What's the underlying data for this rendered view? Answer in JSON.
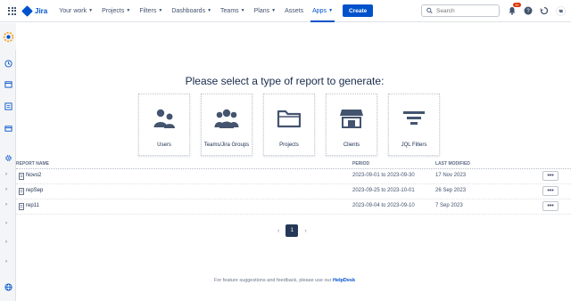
{
  "nav": {
    "logo_text": "Jira",
    "items": [
      {
        "label": "Your work",
        "chevron": true
      },
      {
        "label": "Projects",
        "chevron": true
      },
      {
        "label": "Filters",
        "chevron": true
      },
      {
        "label": "Dashboards",
        "chevron": true
      },
      {
        "label": "Teams",
        "chevron": true
      },
      {
        "label": "Plans",
        "chevron": true
      },
      {
        "label": "Assets",
        "chevron": false
      },
      {
        "label": "Apps",
        "chevron": true,
        "active": true
      }
    ],
    "create_label": "Create",
    "search_placeholder": "Search",
    "notification_count": "9+"
  },
  "main": {
    "heading": "Please select a type of report to generate:",
    "report_types": [
      {
        "label": "Users",
        "icon": "users-icon"
      },
      {
        "label": "Teams/Jira Groups",
        "icon": "groups-icon"
      },
      {
        "label": "Projects",
        "icon": "folder-icon"
      },
      {
        "label": "Clients",
        "icon": "store-icon"
      },
      {
        "label": "JQL Filters",
        "icon": "filter-icon"
      }
    ],
    "table": {
      "columns": {
        "name": "REPORT NAME",
        "period": "PERIOD",
        "modified": "LAST MODIFIED"
      },
      "rows": [
        {
          "name": "Novo2",
          "period": "2023-09-01 to 2023-09-30",
          "modified": "17 Nov 2023"
        },
        {
          "name": "repSep",
          "period": "2023-09-25 to 2023-10-01",
          "modified": "26 Sep 2023"
        },
        {
          "name": "rep11",
          "period": "2023-09-04 to 2023-09-10",
          "modified": "7 Sep 2023"
        }
      ],
      "row_action_label": "•••"
    },
    "pagination": {
      "current": "1",
      "prev": "‹",
      "next": "›"
    },
    "footer": {
      "text": "For feature suggestions and feedback, please use our ",
      "link": "HelpDesk"
    }
  },
  "colors": {
    "brand": "#0052cc",
    "text": "#172b4d",
    "pager_active": "#253858"
  }
}
